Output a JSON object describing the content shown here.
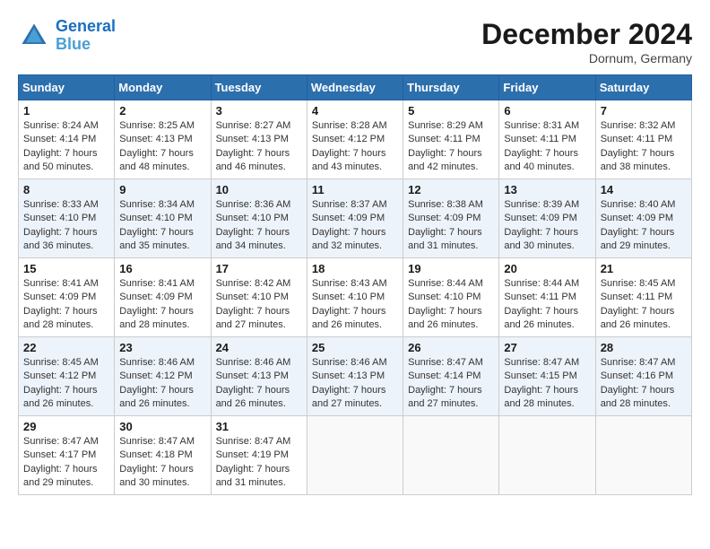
{
  "header": {
    "logo_line1": "General",
    "logo_line2": "Blue",
    "month_title": "December 2024",
    "location": "Dornum, Germany"
  },
  "days_of_week": [
    "Sunday",
    "Monday",
    "Tuesday",
    "Wednesday",
    "Thursday",
    "Friday",
    "Saturday"
  ],
  "weeks": [
    [
      {
        "day": "1",
        "sunrise": "8:24 AM",
        "sunset": "4:14 PM",
        "daylight": "7 hours and 50 minutes."
      },
      {
        "day": "2",
        "sunrise": "8:25 AM",
        "sunset": "4:13 PM",
        "daylight": "7 hours and 48 minutes."
      },
      {
        "day": "3",
        "sunrise": "8:27 AM",
        "sunset": "4:13 PM",
        "daylight": "7 hours and 46 minutes."
      },
      {
        "day": "4",
        "sunrise": "8:28 AM",
        "sunset": "4:12 PM",
        "daylight": "7 hours and 43 minutes."
      },
      {
        "day": "5",
        "sunrise": "8:29 AM",
        "sunset": "4:11 PM",
        "daylight": "7 hours and 42 minutes."
      },
      {
        "day": "6",
        "sunrise": "8:31 AM",
        "sunset": "4:11 PM",
        "daylight": "7 hours and 40 minutes."
      },
      {
        "day": "7",
        "sunrise": "8:32 AM",
        "sunset": "4:11 PM",
        "daylight": "7 hours and 38 minutes."
      }
    ],
    [
      {
        "day": "8",
        "sunrise": "8:33 AM",
        "sunset": "4:10 PM",
        "daylight": "7 hours and 36 minutes."
      },
      {
        "day": "9",
        "sunrise": "8:34 AM",
        "sunset": "4:10 PM",
        "daylight": "7 hours and 35 minutes."
      },
      {
        "day": "10",
        "sunrise": "8:36 AM",
        "sunset": "4:10 PM",
        "daylight": "7 hours and 34 minutes."
      },
      {
        "day": "11",
        "sunrise": "8:37 AM",
        "sunset": "4:09 PM",
        "daylight": "7 hours and 32 minutes."
      },
      {
        "day": "12",
        "sunrise": "8:38 AM",
        "sunset": "4:09 PM",
        "daylight": "7 hours and 31 minutes."
      },
      {
        "day": "13",
        "sunrise": "8:39 AM",
        "sunset": "4:09 PM",
        "daylight": "7 hours and 30 minutes."
      },
      {
        "day": "14",
        "sunrise": "8:40 AM",
        "sunset": "4:09 PM",
        "daylight": "7 hours and 29 minutes."
      }
    ],
    [
      {
        "day": "15",
        "sunrise": "8:41 AM",
        "sunset": "4:09 PM",
        "daylight": "7 hours and 28 minutes."
      },
      {
        "day": "16",
        "sunrise": "8:41 AM",
        "sunset": "4:09 PM",
        "daylight": "7 hours and 28 minutes."
      },
      {
        "day": "17",
        "sunrise": "8:42 AM",
        "sunset": "4:10 PM",
        "daylight": "7 hours and 27 minutes."
      },
      {
        "day": "18",
        "sunrise": "8:43 AM",
        "sunset": "4:10 PM",
        "daylight": "7 hours and 26 minutes."
      },
      {
        "day": "19",
        "sunrise": "8:44 AM",
        "sunset": "4:10 PM",
        "daylight": "7 hours and 26 minutes."
      },
      {
        "day": "20",
        "sunrise": "8:44 AM",
        "sunset": "4:11 PM",
        "daylight": "7 hours and 26 minutes."
      },
      {
        "day": "21",
        "sunrise": "8:45 AM",
        "sunset": "4:11 PM",
        "daylight": "7 hours and 26 minutes."
      }
    ],
    [
      {
        "day": "22",
        "sunrise": "8:45 AM",
        "sunset": "4:12 PM",
        "daylight": "7 hours and 26 minutes."
      },
      {
        "day": "23",
        "sunrise": "8:46 AM",
        "sunset": "4:12 PM",
        "daylight": "7 hours and 26 minutes."
      },
      {
        "day": "24",
        "sunrise": "8:46 AM",
        "sunset": "4:13 PM",
        "daylight": "7 hours and 26 minutes."
      },
      {
        "day": "25",
        "sunrise": "8:46 AM",
        "sunset": "4:13 PM",
        "daylight": "7 hours and 27 minutes."
      },
      {
        "day": "26",
        "sunrise": "8:47 AM",
        "sunset": "4:14 PM",
        "daylight": "7 hours and 27 minutes."
      },
      {
        "day": "27",
        "sunrise": "8:47 AM",
        "sunset": "4:15 PM",
        "daylight": "7 hours and 28 minutes."
      },
      {
        "day": "28",
        "sunrise": "8:47 AM",
        "sunset": "4:16 PM",
        "daylight": "7 hours and 28 minutes."
      }
    ],
    [
      {
        "day": "29",
        "sunrise": "8:47 AM",
        "sunset": "4:17 PM",
        "daylight": "7 hours and 29 minutes."
      },
      {
        "day": "30",
        "sunrise": "8:47 AM",
        "sunset": "4:18 PM",
        "daylight": "7 hours and 30 minutes."
      },
      {
        "day": "31",
        "sunrise": "8:47 AM",
        "sunset": "4:19 PM",
        "daylight": "7 hours and 31 minutes."
      },
      null,
      null,
      null,
      null
    ]
  ]
}
